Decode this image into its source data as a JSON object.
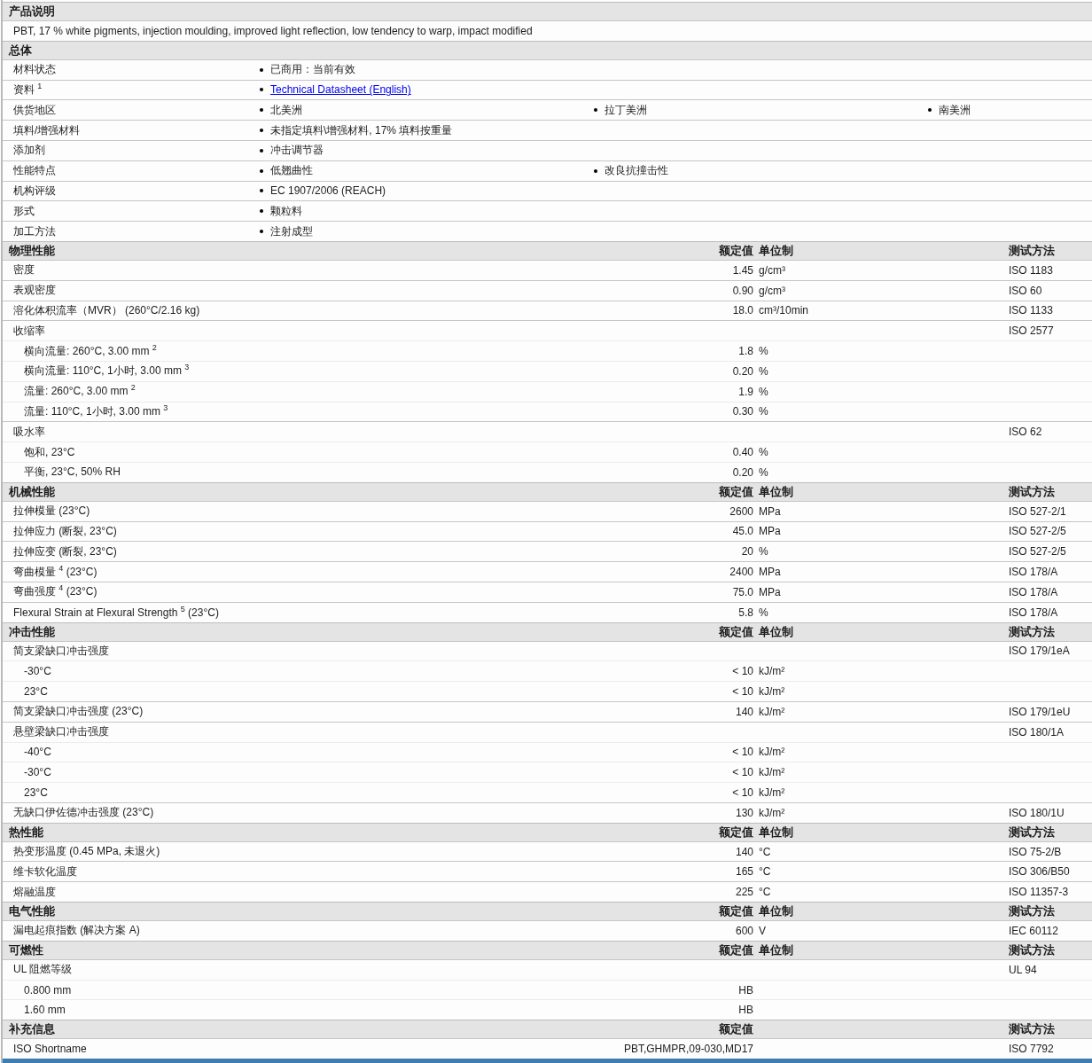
{
  "description": {
    "heading": "产品说明",
    "text": "PBT, 17 % white pigments, injection moulding, improved light reflection, low tendency to warp, impact modified"
  },
  "general": {
    "heading": "总体",
    "rows": [
      {
        "label": "材料状态",
        "values": [
          {
            "text": "已商用：当前有效",
            "kind": "plain"
          }
        ]
      },
      {
        "label": "资料 $^{1}$",
        "values": [
          {
            "text": "Technical Datasheet (English)",
            "kind": "link"
          }
        ]
      },
      {
        "label": "供货地区",
        "values": [
          {
            "text": "北美洲",
            "kind": "plain"
          },
          {
            "text": "拉丁美洲",
            "kind": "plain"
          },
          {
            "text": "南美洲",
            "kind": "plain"
          }
        ]
      },
      {
        "label": "填料/增强材料",
        "values": [
          {
            "text": "未指定填料\\增强材料, 17% 填料按重量",
            "kind": "plain"
          }
        ]
      },
      {
        "label": "添加剂",
        "values": [
          {
            "text": "冲击调节器",
            "kind": "plain"
          }
        ]
      },
      {
        "label": "性能特点",
        "values": [
          {
            "text": "低翘曲性",
            "kind": "plain"
          },
          {
            "text": "改良抗撞击性",
            "kind": "plain"
          }
        ]
      },
      {
        "label": "机构评级",
        "values": [
          {
            "text": "EC 1907/2006 (REACH)",
            "kind": "plain"
          }
        ]
      },
      {
        "label": "形式",
        "values": [
          {
            "text": "颗粒料",
            "kind": "plain"
          }
        ]
      },
      {
        "label": "加工方法",
        "values": [
          {
            "text": "注射成型",
            "kind": "plain"
          }
        ]
      }
    ]
  },
  "sections": [
    {
      "heading": "物理性能",
      "columns": {
        "value": "额定值",
        "unit": "单位制",
        "method": "测试方法"
      },
      "rows": [
        {
          "label": "密度",
          "value": "1.45",
          "unit": "g/cm³",
          "method": "ISO 1183"
        },
        {
          "label": "表观密度",
          "value": "0.90",
          "unit": "g/cm³",
          "method": "ISO 60"
        },
        {
          "label": "溶化体积流率（MVR） (260°C/2.16 kg)",
          "value": "18.0",
          "unit": "cm³/10min",
          "method": "ISO 1133"
        },
        {
          "label": "收缩率",
          "method": "ISO 2577",
          "children": [
            {
              "label": "横向流量: 260°C, 3.00 mm $^{2}$",
              "value": "1.8",
              "unit": "%"
            },
            {
              "label": "横向流量: 110°C, 1小时, 3.00 mm $^{3}$",
              "value": "0.20",
              "unit": "%"
            },
            {
              "label": "流量: 260°C, 3.00 mm $^{2}$",
              "value": "1.9",
              "unit": "%"
            },
            {
              "label": "流量: 110°C, 1小时, 3.00 mm $^{3}$",
              "value": "0.30",
              "unit": "%"
            }
          ]
        },
        {
          "label": "吸水率",
          "method": "ISO 62",
          "children": [
            {
              "label": "饱和, 23°C",
              "value": "0.40",
              "unit": "%"
            },
            {
              "label": "平衡, 23°C, 50% RH",
              "value": "0.20",
              "unit": "%"
            }
          ]
        }
      ]
    },
    {
      "heading": "机械性能",
      "columns": {
        "value": "额定值",
        "unit": "单位制",
        "method": "测试方法"
      },
      "rows": [
        {
          "label": "拉伸模量 (23°C)",
          "value": "2600",
          "unit": "MPa",
          "method": "ISO 527-2/1"
        },
        {
          "label": "拉伸应力 (断裂, 23°C)",
          "value": "45.0",
          "unit": "MPa",
          "method": "ISO 527-2/5"
        },
        {
          "label": "拉伸应变 (断裂, 23°C)",
          "value": "20",
          "unit": "%",
          "method": "ISO 527-2/5"
        },
        {
          "label": "弯曲模量 $^{4}$ (23°C)",
          "value": "2400",
          "unit": "MPa",
          "method": "ISO 178/A"
        },
        {
          "label": "弯曲强度 $^{4}$ (23°C)",
          "value": "75.0",
          "unit": "MPa",
          "method": "ISO 178/A"
        },
        {
          "label": "Flexural Strain at Flexural Strength $^{5}$ (23°C)",
          "value": "5.8",
          "unit": "%",
          "method": "ISO 178/A"
        }
      ]
    },
    {
      "heading": "冲击性能",
      "columns": {
        "value": "额定值",
        "unit": "单位制",
        "method": "测试方法"
      },
      "rows": [
        {
          "label": "简支梁缺口冲击强度",
          "method": "ISO 179/1eA",
          "children": [
            {
              "label": "-30°C",
              "value": "< 10",
              "unit": "kJ/m²"
            },
            {
              "label": "23°C",
              "value": "< 10",
              "unit": "kJ/m²"
            }
          ]
        },
        {
          "label": "简支梁缺口冲击强度 (23°C)",
          "value": "140",
          "unit": "kJ/m²",
          "method": "ISO 179/1eU"
        },
        {
          "label": "悬壁梁缺口冲击强度",
          "method": "ISO 180/1A",
          "children": [
            {
              "label": "-40°C",
              "value": "< 10",
              "unit": "kJ/m²"
            },
            {
              "label": "-30°C",
              "value": "< 10",
              "unit": "kJ/m²"
            },
            {
              "label": "23°C",
              "value": "< 10",
              "unit": "kJ/m²"
            }
          ]
        },
        {
          "label": "无缺口伊佐德冲击强度 (23°C)",
          "value": "130",
          "unit": "kJ/m²",
          "method": "ISO 180/1U"
        }
      ]
    },
    {
      "heading": "热性能",
      "columns": {
        "value": "额定值",
        "unit": "单位制",
        "method": "测试方法"
      },
      "rows": [
        {
          "label": "热变形温度 (0.45 MPa, 未退火)",
          "value": "140",
          "unit": "°C",
          "method": "ISO 75-2/B"
        },
        {
          "label": "维卡软化温度",
          "value": "165",
          "unit": "°C",
          "method": "ISO 306/B50"
        },
        {
          "label": "熔融温度",
          "value": "225",
          "unit": "°C",
          "method": "ISO 11357-3"
        }
      ]
    },
    {
      "heading": "电气性能",
      "columns": {
        "value": "额定值",
        "unit": "单位制",
        "method": "测试方法"
      },
      "rows": [
        {
          "label": "漏电起痕指数 (解决方案 A)",
          "value": "600",
          "unit": "V",
          "method": "IEC 60112"
        }
      ]
    },
    {
      "heading": "可燃性",
      "columns": {
        "value": "额定值",
        "unit": "单位制",
        "method": "测试方法"
      },
      "rows": [
        {
          "label": "UL 阻燃等级",
          "method": "UL 94",
          "children": [
            {
              "label": "0.800 mm",
              "value": "HB"
            },
            {
              "label": "1.60 mm",
              "value": "HB"
            }
          ]
        }
      ]
    },
    {
      "heading": "补充信息",
      "columns": {
        "value": "额定值",
        "method": "测试方法"
      },
      "rows": [
        {
          "label": "ISO Shortname",
          "value": "PBT,GHMPR,09-030,MD17",
          "method": "ISO 7792"
        }
      ]
    }
  ]
}
